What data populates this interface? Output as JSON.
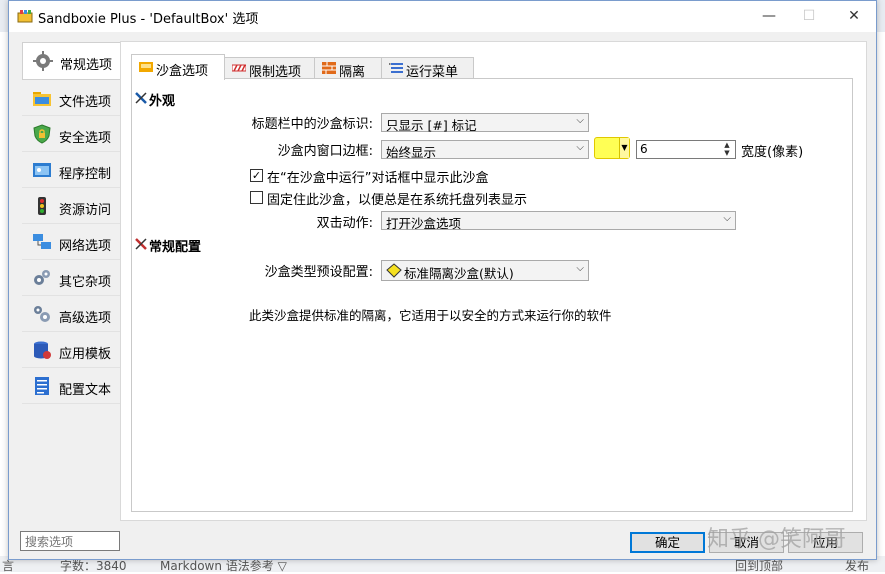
{
  "window": {
    "title": "Sandboxie Plus - 'DefaultBox' 选项"
  },
  "titlebar_buttons": {
    "minimize": "—",
    "maximize": "☐",
    "close": "✕"
  },
  "sidebar": {
    "items": [
      {
        "label": "常规选项",
        "icon": "gear-icon",
        "active": true
      },
      {
        "label": "文件选项",
        "icon": "folder-icon"
      },
      {
        "label": "安全选项",
        "icon": "shield-icon"
      },
      {
        "label": "程序控制",
        "icon": "app-window-icon"
      },
      {
        "label": "资源访问",
        "icon": "traffic-light-icon"
      },
      {
        "label": "网络选项",
        "icon": "network-icon"
      },
      {
        "label": "其它杂项",
        "icon": "gears-icon"
      },
      {
        "label": "高级选项",
        "icon": "gears-advanced-icon"
      },
      {
        "label": "应用模板",
        "icon": "database-icon"
      },
      {
        "label": "配置文本",
        "icon": "text-doc-icon"
      }
    ]
  },
  "tabs": [
    {
      "label": "沙盒选项",
      "icon": "sandbox-icon",
      "active": true
    },
    {
      "label": "限制选项",
      "icon": "restriction-icon"
    },
    {
      "label": "隔离",
      "icon": "wall-icon"
    },
    {
      "label": "运行菜单",
      "icon": "menu-icon"
    }
  ],
  "appearance": {
    "section_title": "外观",
    "title_marker_label": "标题栏中的沙盒标识:",
    "title_marker_value": "只显示 [#] 标记",
    "border_label": "沙盒内窗口边框:",
    "border_value": "始终显示",
    "border_color": "#ffff55",
    "border_width": "6",
    "border_width_unit": "宽度(像素)",
    "show_in_run_dialog": "在“在沙盒中运行”对话框中显示此沙盒",
    "show_in_run_dialog_checked": true,
    "pin_to_tray": "固定住此沙盒，以便总是在系统托盘列表显示",
    "pin_to_tray_checked": false,
    "double_click_label": "双击动作:",
    "double_click_value": "打开沙盒选项"
  },
  "general_config": {
    "section_title": "常规配置",
    "preset_label": "沙盒类型预设配置:",
    "preset_value": "标准隔离沙盒(默认)",
    "description": "此类沙盒提供标准的隔离，它适用于以安全的方式来运行你的软件"
  },
  "search": {
    "placeholder": "搜索选项"
  },
  "buttons": {
    "ok": "确定",
    "cancel": "取消",
    "apply": "应用"
  },
  "watermark": "知乎 @笑阿哥",
  "background_text": {
    "left": "言",
    "count": "字数：3840",
    "middle": "Markdown 语法参考 ▽",
    "right1": "回到顶部",
    "right2": "发布"
  }
}
